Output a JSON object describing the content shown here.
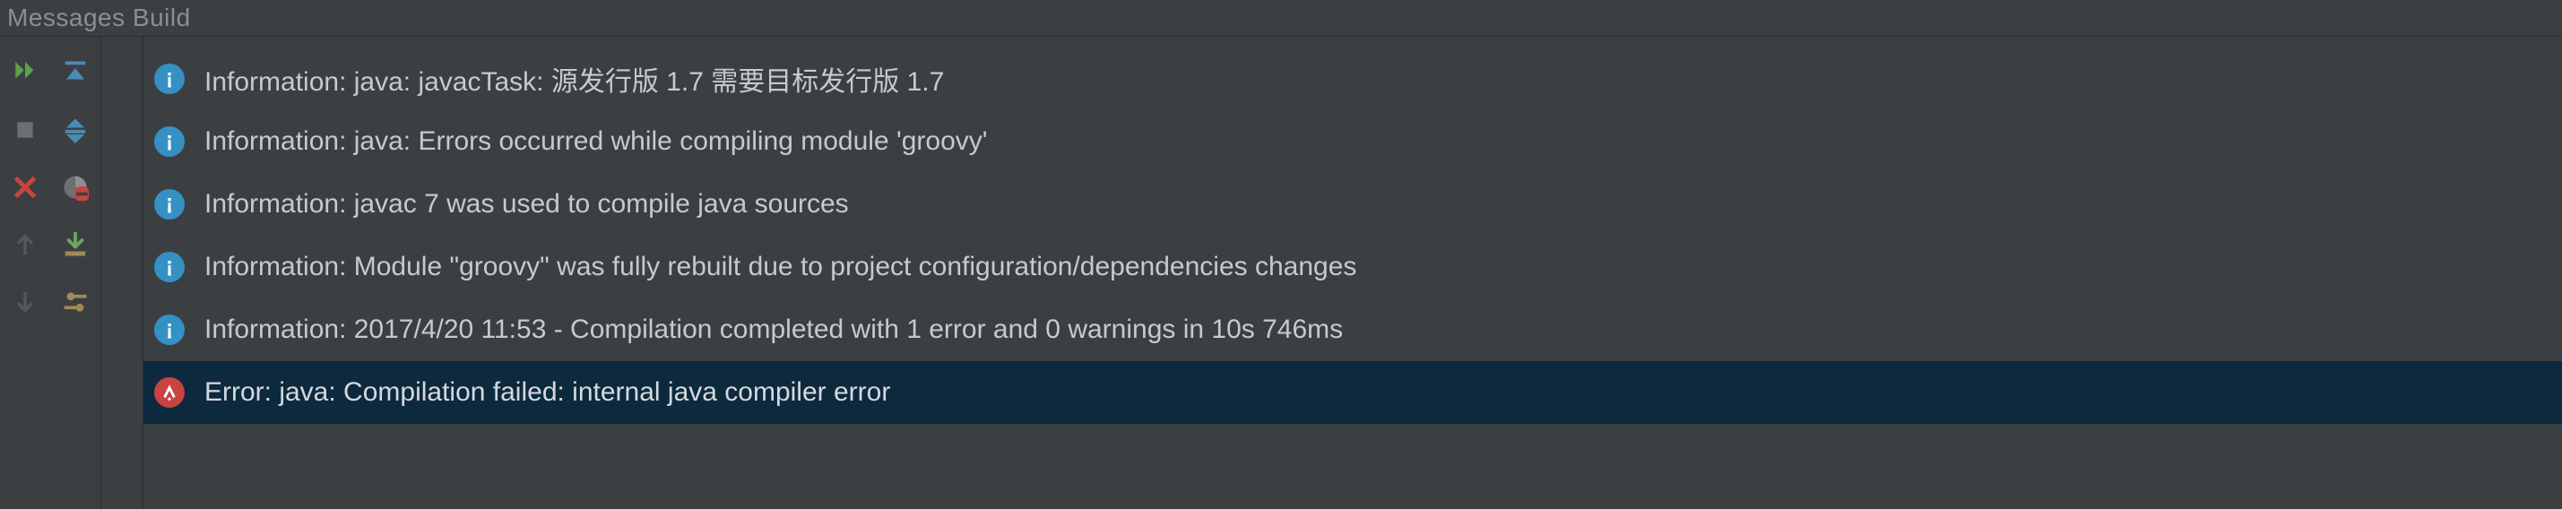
{
  "title": "Messages Build",
  "messages": [
    {
      "kind": "info",
      "text": "Information: java: javacTask: 源发行版 1.7 需要目标发行版 1.7",
      "selected": false
    },
    {
      "kind": "info",
      "text": "Information: java: Errors occurred while compiling module 'groovy'",
      "selected": false
    },
    {
      "kind": "info",
      "text": "Information: javac 7 was used to compile java sources",
      "selected": false
    },
    {
      "kind": "info",
      "text": "Information: Module \"groovy\" was fully rebuilt due to project configuration/dependencies changes",
      "selected": false
    },
    {
      "kind": "info",
      "text": "Information: 2017/4/20 11:53 - Compilation completed with 1 error and 0 warnings in 10s 746ms",
      "selected": false
    },
    {
      "kind": "error",
      "text": "Error: java: Compilation failed: internal java compiler error",
      "selected": true
    }
  ],
  "toolbar_left": [
    "rerun",
    "stop",
    "close",
    "prev-message",
    "next-message"
  ],
  "toolbar_right": [
    "expand-all",
    "collapse-all",
    "filter-errors",
    "export",
    "settings"
  ]
}
